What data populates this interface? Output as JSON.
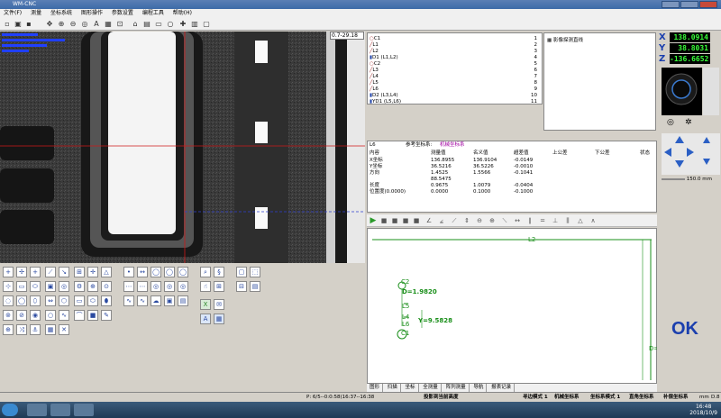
{
  "window": {
    "title": "WM-CNC",
    "menu": [
      "文件(F)",
      "测量",
      "坐标系统",
      "图形操作",
      "参数设置",
      "编程工具",
      "帮助(H)"
    ]
  },
  "camera": {
    "zoom": "0.7-29.18"
  },
  "feature_list": [
    {
      "name": "C1",
      "num": "1",
      "icon": "circle-icon"
    },
    {
      "name": "L1",
      "num": "2",
      "icon": "line-icon"
    },
    {
      "name": "L2",
      "num": "3",
      "icon": "line-icon"
    },
    {
      "name": "D1 (L1,L2)",
      "num": "4",
      "icon": "distance-icon"
    },
    {
      "name": "C2",
      "num": "5",
      "icon": "circle-icon"
    },
    {
      "name": "L3",
      "num": "6",
      "icon": "line-icon"
    },
    {
      "name": "L4",
      "num": "7",
      "icon": "line-icon"
    },
    {
      "name": "L5",
      "num": "8",
      "icon": "line-icon"
    },
    {
      "name": "L6",
      "num": "9",
      "icon": "line-icon"
    },
    {
      "name": "D2 (L3,L4)",
      "num": "10",
      "icon": "distance-icon"
    },
    {
      "name": "YD1 (L5,L6)",
      "num": "11",
      "icon": "distance-icon"
    }
  ],
  "property_box": {
    "label": "影像探测直线"
  },
  "coords": {
    "x_label": "X",
    "x_value": "138.0914",
    "y_label": "Y",
    "y_value": "38.8031",
    "z_label": "Z",
    "z_value": "-136.6652"
  },
  "speed": {
    "value": "150.0",
    "unit": "mm"
  },
  "results": {
    "feature": "L6",
    "ref_label": "参考坐标系:",
    "ref_value": "机械坐标系",
    "headers": [
      "内容",
      "测量值",
      "名义值",
      "超差值",
      "上公差",
      "下公差",
      "状态"
    ],
    "rows": [
      [
        "X坐标",
        "136.8955",
        "136.9104",
        "-0.0149",
        "",
        "",
        ""
      ],
      [
        "Y坐标",
        "36.5216",
        "36.5226",
        "-0.0010",
        "",
        "",
        ""
      ],
      [
        "方向",
        "1.4525",
        "1.5566",
        "-0.1041",
        "",
        "",
        ""
      ],
      [
        "",
        "88.5475",
        "",
        "",
        "",
        "",
        ""
      ],
      [
        "长度",
        "0.9675",
        "1.0079",
        "-0.0404",
        "",
        "",
        ""
      ],
      [
        "位置度(0.0000)",
        "0.0000",
        "0.1000",
        "-0.1000",
        "",
        "",
        ""
      ]
    ]
  },
  "graphic": {
    "label_l2": "L2",
    "label_c2": "C2",
    "label_d": "D=1.9820",
    "label_l5": "L5",
    "label_l4": "L4",
    "label_l6": "L6",
    "label_y": "Y=9.5828",
    "label_c1": "C1",
    "label_d_right": "D="
  },
  "bottom_tabs": [
    "图形",
    "扫描",
    "坐标",
    "全测量",
    "阵列测量",
    "导航",
    "报表记录"
  ],
  "ok_text": "OK",
  "status": {
    "position": "P: 6/5--0:0:58(16:37--16:38",
    "projection": "投影到当前高度",
    "mode1": "寻边模式 1",
    "coord_system": "机械坐标系",
    "coord_mode": "坐标系模式 1",
    "straight_coord": "直角坐标系",
    "compensation": "补偿坐标系",
    "unit": "mm",
    "dec": "D.8"
  },
  "clock": {
    "time": "16:48",
    "date": "2018/10/9"
  }
}
